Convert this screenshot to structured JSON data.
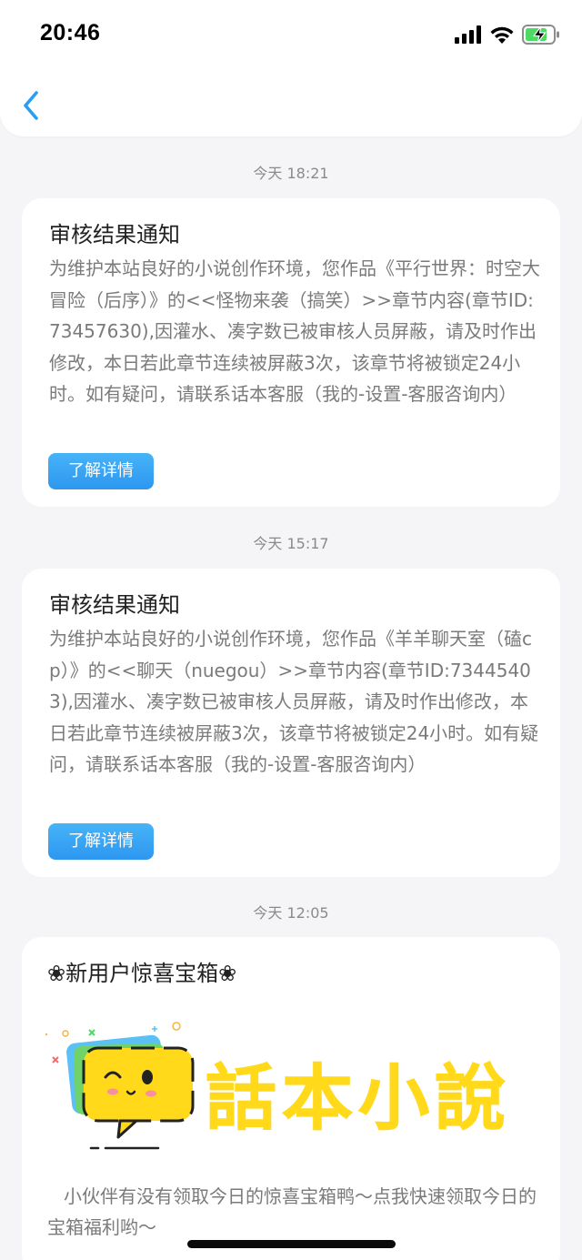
{
  "status_bar": {
    "time": "20:46",
    "icons": [
      "signal-icon",
      "wifi-icon",
      "battery-charging-icon"
    ]
  },
  "nav": {
    "back_icon": "chevron-left-icon"
  },
  "messages": [
    {
      "timestamp": "今天 18:21",
      "title": "审核结果通知",
      "body": "为维护本站良好的小说创作环境，您作品《平行世界：时空大冒险（后序）》的<<怪物来袭（搞笑）>>章节内容(章节ID:73457630),因灌水、凑字数已被审核人员屏蔽，请及时作出修改，本日若此章节连续被屏蔽3次，该章节将被锁定24小时。如有疑问，请联系话本客服（我的-设置-客服咨询内）",
      "button": "了解详情"
    },
    {
      "timestamp": "今天 15:17",
      "title": "审核结果通知",
      "body": "为维护本站良好的小说创作环境，您作品《羊羊聊天室（磕cp）》的<<聊天（nuegou）>>章节内容(章节ID:73445403),因灌水、凑字数已被审核人员屏蔽，请及时作出修改，本日若此章节连续被屏蔽3次，该章节将被锁定24小时。如有疑问，请联系话本客服（我的-设置-客服咨询内）",
      "button": "了解详情"
    }
  ],
  "promo": {
    "timestamp": "今天 12:05",
    "title": "❀新用户惊喜宝箱❀",
    "logo_text": "話本小說",
    "text": "小伙伴有没有领取今日的惊喜宝箱鸭～点我快速领取今日的宝箱福利哟～"
  },
  "colors": {
    "accent": "#2d97f0",
    "back_arrow": "#2a9df4",
    "logo_yellow": "#ffd91a",
    "battery_green": "#4cd964",
    "background": "#f5f4f7"
  }
}
